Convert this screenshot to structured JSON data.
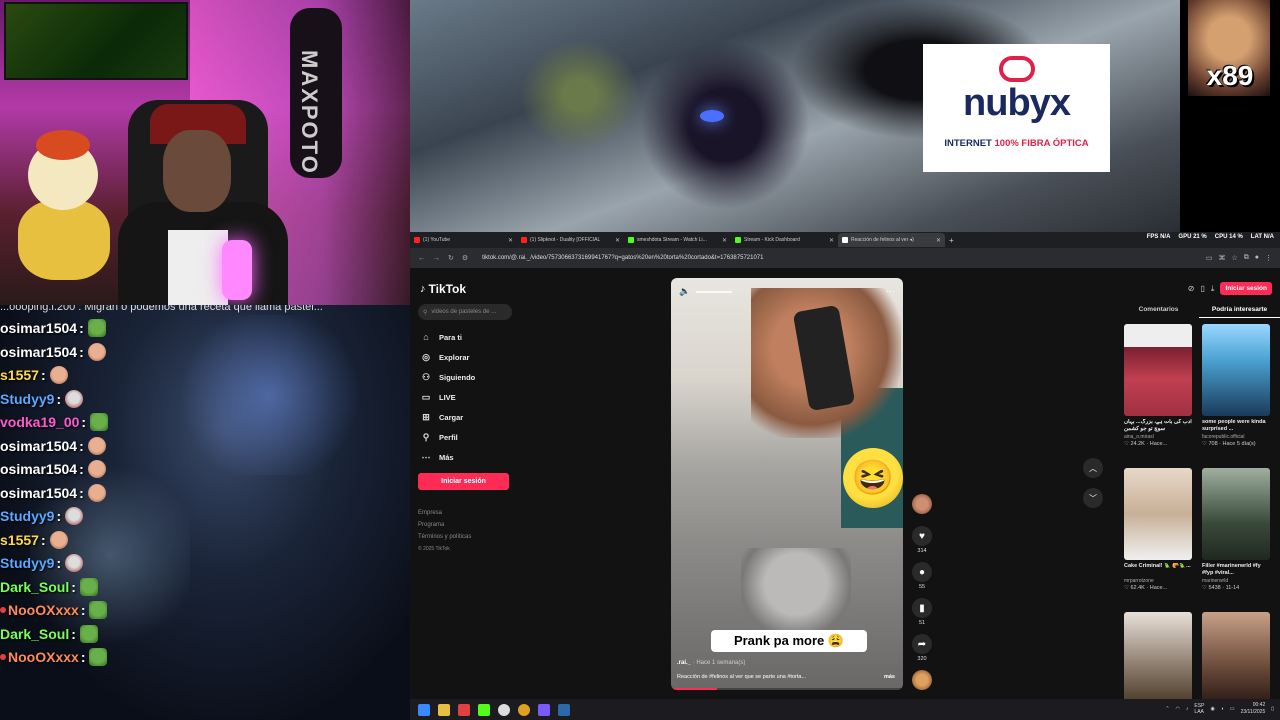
{
  "webcam": {
    "bag_text": "MAXPOTO"
  },
  "overlay": {
    "counter": "x89"
  },
  "sponsor": {
    "name": "nubyx",
    "tag_prefix": "INTERNET ",
    "tag_highlight": "100% FIBRA ÓPTICA"
  },
  "chat": {
    "top_line": "...oooping.i.200 : Migran o podemos una receta que llama pastel...",
    "messages": [
      {
        "user": "osimar1504",
        "color": "#ffffff",
        "emote": "frog"
      },
      {
        "user": "osimar1504",
        "color": "#ffffff",
        "emote": "face"
      },
      {
        "user": "s1557",
        "color": "#ffd84a",
        "emote": "face"
      },
      {
        "user": "Studyy9",
        "color": "#5aa8ff",
        "emote": "mask"
      },
      {
        "user": "vodka19_00",
        "color": "#ff5ad0",
        "emote": "frog"
      },
      {
        "user": "osimar1504",
        "color": "#ffffff",
        "emote": "face"
      },
      {
        "user": "osimar1504",
        "color": "#ffffff",
        "emote": "face"
      },
      {
        "user": "osimar1504",
        "color": "#ffffff",
        "emote": "face"
      },
      {
        "user": "Studyy9",
        "color": "#5aa8ff",
        "emote": "mask"
      },
      {
        "user": "s1557",
        "color": "#ffd84a",
        "emote": "face"
      },
      {
        "user": "Studyy9",
        "color": "#5aa8ff",
        "emote": "mask"
      },
      {
        "user": "Dark_Soul",
        "color": "#7aff5a",
        "emote": "frog"
      },
      {
        "user": "NooOXxxx",
        "color": "#ff8a5a",
        "emote": "frog",
        "dot": true
      },
      {
        "user": "Dark_Soul",
        "color": "#7aff5a",
        "emote": "frog"
      },
      {
        "user": "NooOXxxx",
        "color": "#ff8a5a",
        "emote": "frog",
        "dot": true
      }
    ]
  },
  "browser": {
    "tabs": [
      {
        "label": "(1) YouTube",
        "color": "#ff2020"
      },
      {
        "label": "(1) Slipknot - Duality [OFFICIAL",
        "color": "#ff2020"
      },
      {
        "label": "smeshdota Stream - Watch Li...",
        "color": "#53fc18"
      },
      {
        "label": "Stream - Kick Dashboard",
        "color": "#53fc18"
      },
      {
        "label": "Reacción de felinos al ver ◂)",
        "color": "#ffffff"
      }
    ],
    "stats": {
      "fps": "FPS N/A",
      "gpu": "GPU 21 %",
      "cpu": "CPU 14 %",
      "lat": "LAT N/A"
    },
    "url": "tiktok.com/@.rai._/video/7573066373169941767?q=gatos%20en%20torta%20cortado&t=1763875721071"
  },
  "tiktok": {
    "logo": "TikTok",
    "search_placeholder": "videos de pasteles de ...",
    "nav": [
      {
        "label": "Para ti",
        "icon": "⌂"
      },
      {
        "label": "Explorar",
        "icon": "◎"
      },
      {
        "label": "Siguiendo",
        "icon": "⚇"
      },
      {
        "label": "LIVE",
        "icon": "▭"
      },
      {
        "label": "Cargar",
        "icon": "⊞"
      },
      {
        "label": "Perfil",
        "icon": "⚲"
      },
      {
        "label": "Más",
        "icon": "⋯"
      }
    ],
    "login": "Iniciar sesión",
    "footer": [
      "Empresa",
      "Programa",
      "Términos y políticas",
      "© 2025 TikTok"
    ],
    "video": {
      "caption": "Prank pa more 😩",
      "author": ".rai._",
      "time": "· Hace 1 semana(s)",
      "description": "Reacción de #felinos al ver que se parte una #torta...",
      "more": "más",
      "progress": 0.2
    },
    "actions": {
      "likes": "314",
      "comments": "55",
      "saves": "51",
      "shares": "320"
    },
    "right": {
      "login": "Iniciar sesión",
      "tab_comments": "Comentarios",
      "tab_interest": "Podría interesarte",
      "cards": [
        {
          "title": "ادب کی بات ہے، بزرگ... بہاں سوچ تو جو کشمن",
          "author": "aina_o.mirasl",
          "meta": "♡ 24.2K · Hace...",
          "thumb": "linear-gradient(180deg,#eee 0 25%,#7a2030 25%,#c04050 60%,#a03040)"
        },
        {
          "title": "some people were kinda surprised ...",
          "author": "facorepublic.official",
          "meta": "♡ 708 · Hace 5 día(s)",
          "thumb": "linear-gradient(180deg,#9ad8ff,#4aa0d0 40%,#1a3a5a)"
        },
        {
          "title": "Cake Criminal! 🦜 🥐🦜...",
          "author": "mrparrotzone",
          "meta": "♡ 62.4K · Hace...",
          "thumb": "linear-gradient(180deg,#e8d8c8,#c8b098 50%,#f0f0f0)"
        },
        {
          "title": "Filler #marinerwrld #fy #fyp #viral...",
          "author": "marinerwrld",
          "meta": "♡ 5438 · 11-14",
          "thumb": "linear-gradient(180deg,#a0b0a0,#3a4a3a 60%,#202820)"
        },
        {
          "title": "",
          "author": "",
          "meta": "",
          "thumb": "linear-gradient(180deg,#e8e0d8,#8a7a6a 60%,#4a3a2a)"
        },
        {
          "title": "",
          "author": "",
          "meta": "",
          "thumb": "linear-gradient(180deg,#c8a088,#6a4a3a 60%,#2a1a14)"
        }
      ]
    }
  },
  "taskbar": {
    "lang": "ESP\nLAA",
    "time": "00:42",
    "date": "23/11/2025"
  }
}
